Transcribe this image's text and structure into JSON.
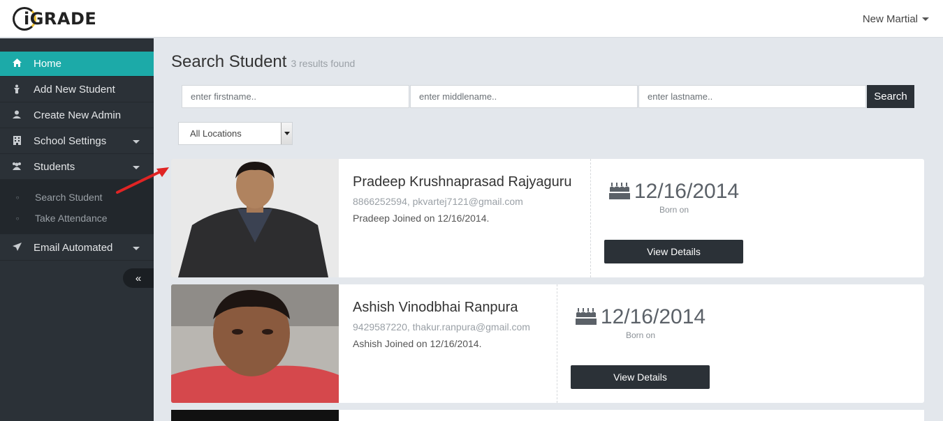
{
  "app": {
    "logo_text": "iGRADE",
    "user_name": "New Martial"
  },
  "sidebar": {
    "items": [
      {
        "label": "Home",
        "icon": "home-icon",
        "active": true
      },
      {
        "label": "Add New Student",
        "icon": "person-icon"
      },
      {
        "label": "Create New Admin",
        "icon": "user-icon"
      },
      {
        "label": "School Settings",
        "icon": "building-icon"
      },
      {
        "label": "Students",
        "icon": "users-icon"
      },
      {
        "label": "Email Automated",
        "icon": "paper-plane-icon"
      }
    ],
    "sub_items": [
      {
        "label": "Search Student"
      },
      {
        "label": "Take Attendance"
      }
    ],
    "collapse_label": "«"
  },
  "main": {
    "title": "Search Student",
    "results": "3 results found",
    "search": {
      "firstname_placeholder": "enter firstname..",
      "middlename_placeholder": "enter middlename..",
      "lastname_placeholder": "enter lastname..",
      "button_label": "Search"
    },
    "location_select": "All Locations",
    "students": [
      {
        "name": "Pradeep Krushnaprasad Rajyaguru",
        "contact": "8866252594, pkvartej7121@gmail.com",
        "joined": "Pradeep Joined on 12/16/2014.",
        "dob": "12/16/2014",
        "born_label": "Born on",
        "button_label": "View Details"
      },
      {
        "name": "Ashish Vinodbhai Ranpura",
        "contact": "9429587220, thakur.ranpura@gmail.com",
        "joined": "Ashish Joined on 12/16/2014.",
        "dob": "12/16/2014",
        "born_label": "Born on",
        "button_label": "View Details"
      }
    ]
  },
  "colors": {
    "sidebar_bg": "#2b3137",
    "accent": "#1caaa8",
    "content_bg": "#e3e7ec",
    "annotation_arrow": "#e02424"
  }
}
